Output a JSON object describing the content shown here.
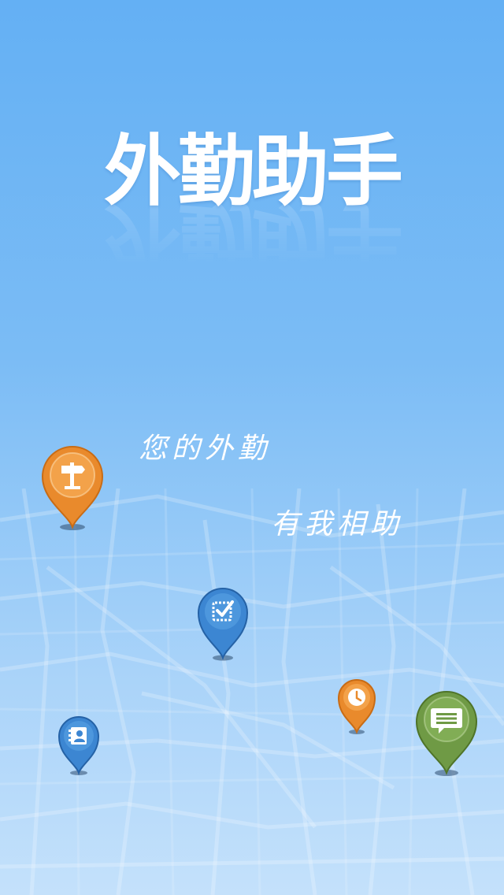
{
  "app": {
    "title": "外勤助手",
    "tagline_1": "您的外勤",
    "tagline_2": "有我相助"
  },
  "colors": {
    "background_top": "#64b0f4",
    "background_bottom": "#c4e1fb",
    "pin_orange": "#e98a2c",
    "pin_blue": "#3c86d2",
    "pin_green": "#6f9a45"
  },
  "pins": [
    {
      "name": "signpost-pin",
      "icon": "signpost-icon",
      "color": "orange"
    },
    {
      "name": "task-check-pin",
      "icon": "checkbox-icon",
      "color": "blue"
    },
    {
      "name": "contacts-pin",
      "icon": "contacts-book-icon",
      "color": "blue"
    },
    {
      "name": "clock-pin",
      "icon": "clock-icon",
      "color": "orange"
    },
    {
      "name": "message-pin",
      "icon": "message-icon",
      "color": "green"
    }
  ]
}
